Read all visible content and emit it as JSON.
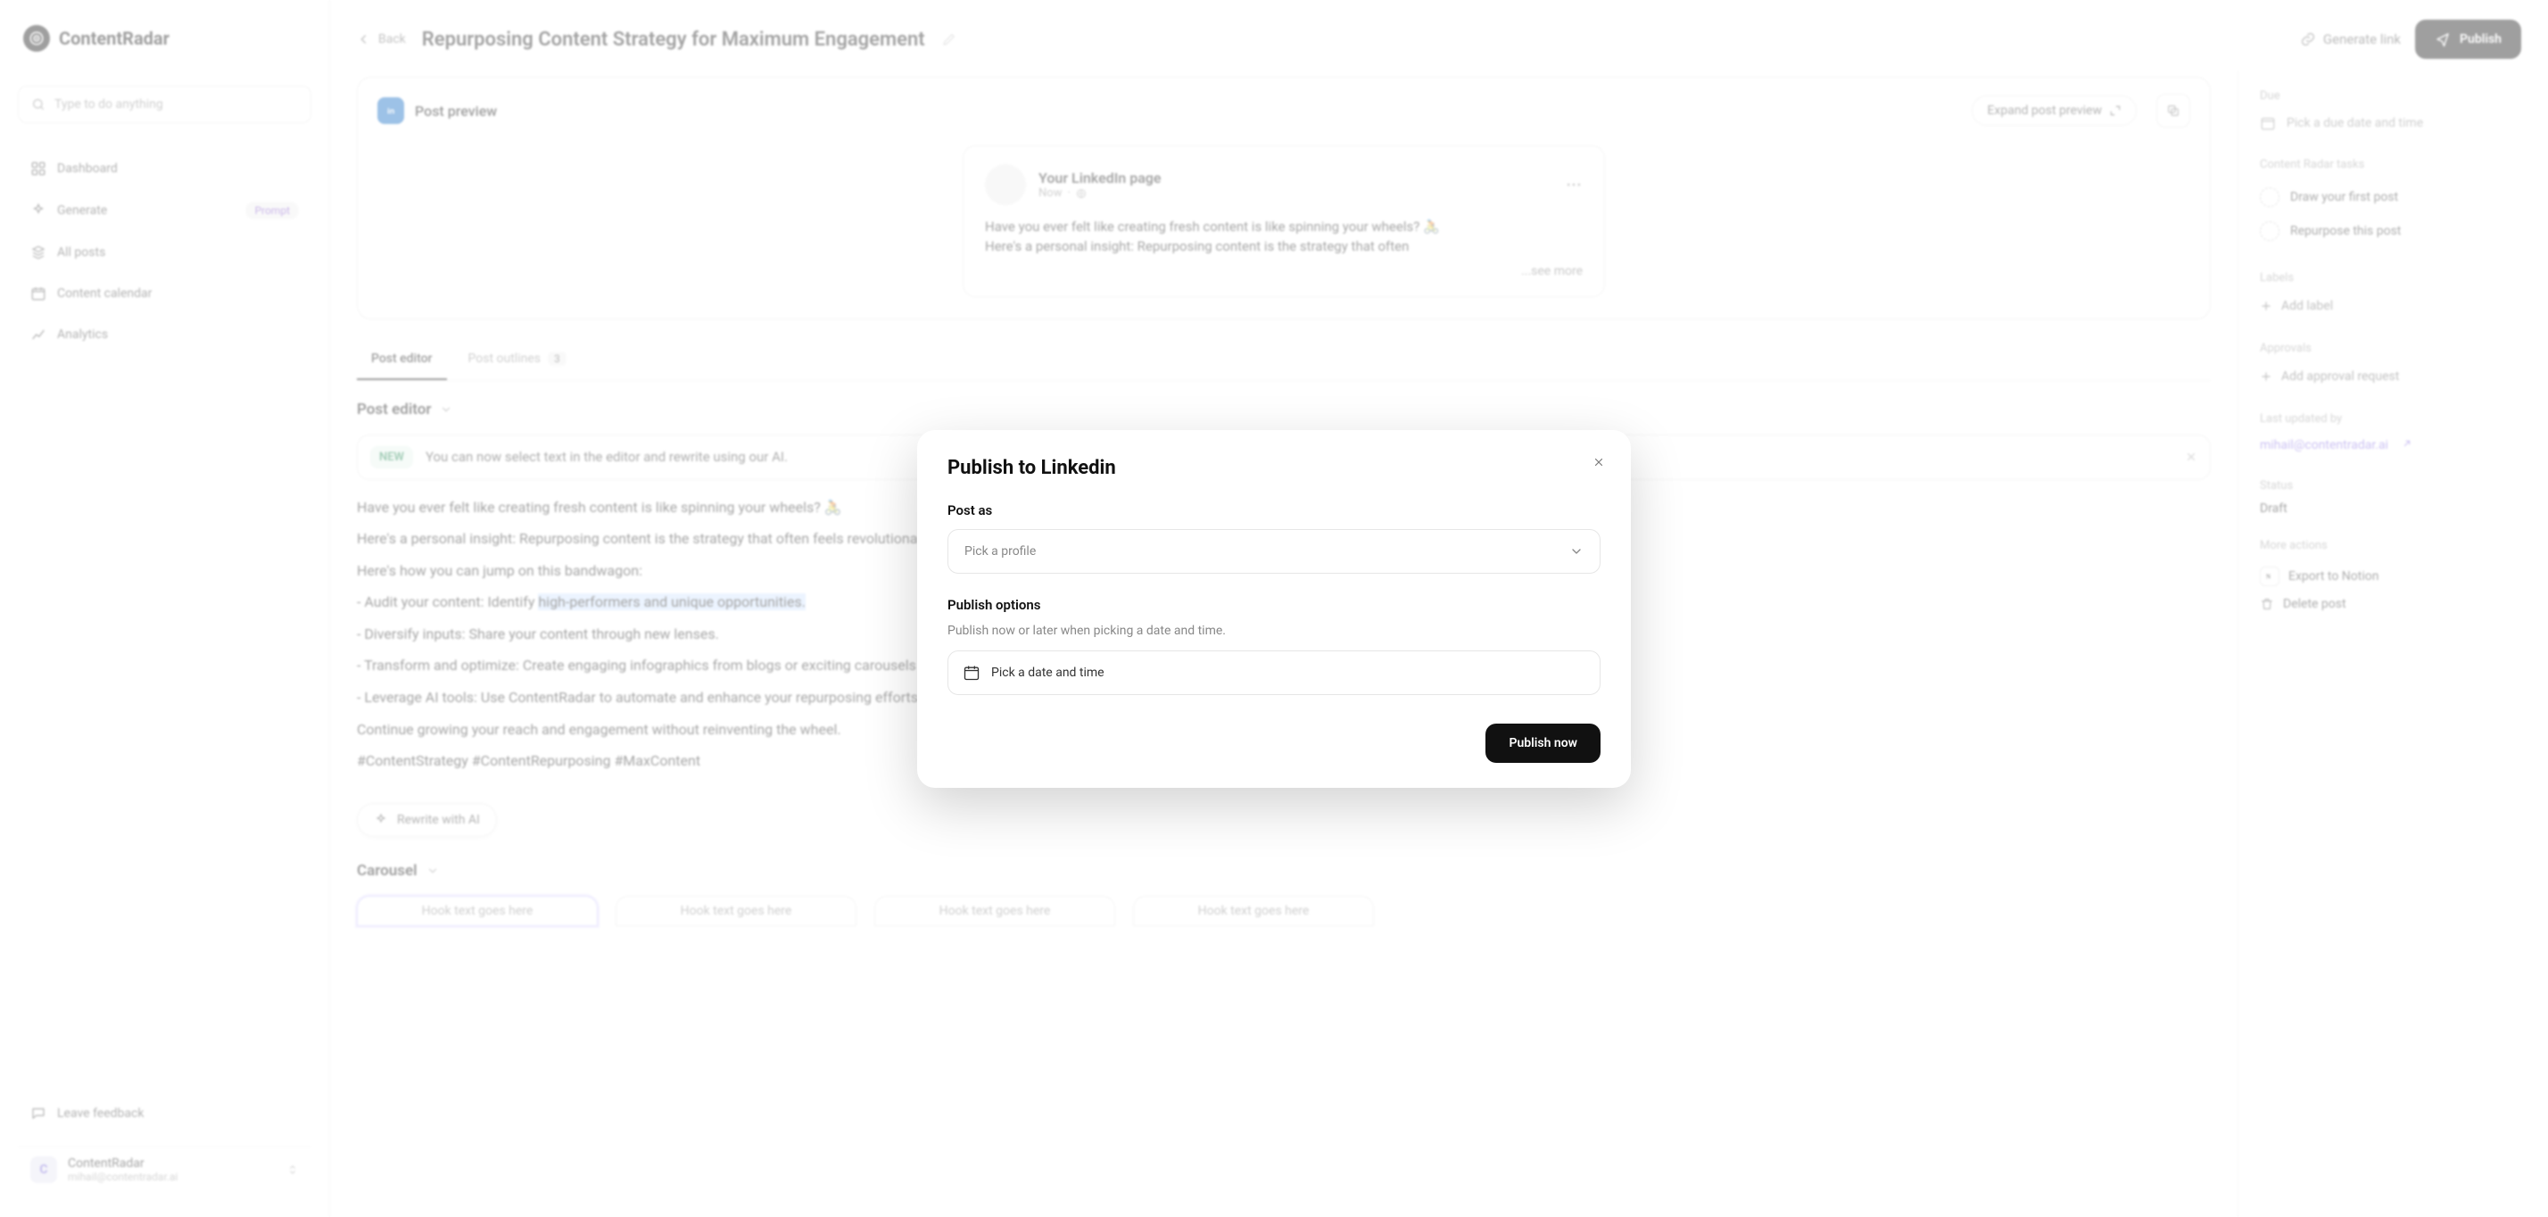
{
  "brand": {
    "name": "ContentRadar"
  },
  "search": {
    "placeholder": "Type to do anything"
  },
  "nav": {
    "dashboard": "Dashboard",
    "generate": "Generate",
    "generate_badge": "Prompt",
    "all_posts": "All posts",
    "content_calendar": "Content calendar",
    "analytics": "Analytics"
  },
  "feedback": "Leave feedback",
  "workspace": {
    "name": "ContentRadar",
    "email": "mihail@contentradar.ai"
  },
  "topbar": {
    "back": "Back",
    "title": "Repurposing Content Strategy for Maximum Engagement",
    "generate_link": "Generate link",
    "publish": "Publish"
  },
  "preview": {
    "label": "Post preview",
    "expand": "Expand post preview",
    "page_name": "Your LinkedIn page",
    "now": "Now",
    "body_line1": "Have you ever felt like creating fresh content is like spinning your wheels? 🚴",
    "body_line2": "Here's a personal insight: Repurposing content is the strategy that often",
    "see_more": "...see more"
  },
  "tabs": {
    "editor": "Post editor",
    "outlines": "Post outlines",
    "outlines_count": "3"
  },
  "editor": {
    "heading": "Post editor",
    "new_chip": "NEW",
    "new_msg": "You can now select text in the editor and rewrite using our AI.",
    "p1": "Have you ever felt like creating fresh content is like spinning your wheels? 🚴",
    "p2a": "Here's a personal insight: Repurposing content is the strategy that often feels revolutionary yet gets overlooked. It's about breathing new life into existing ideas. And that's powerful.",
    "p3": "Here's how you can jump on this bandwagon:",
    "b1a": "- Audit your content: Identify ",
    "b1b": "high-performers and unique opportunities.",
    "b2": "- Diversify inputs: Share your content through new lenses.",
    "b3": "- Transform and optimize: Create engaging infographics from blogs or exciting carousels from PDFs and adjust for each platform.",
    "b4": "- Leverage AI tools: Use ContentRadar to automate and enhance your repurposing efforts.",
    "p4": "Continue growing your reach and engagement without reinventing the wheel.",
    "p5": "#ContentStrategy #ContentRepurposing #MaxContent",
    "rewrite": "Rewrite with AI"
  },
  "carousel": {
    "heading": "Carousel",
    "cards": [
      "Hook text goes here",
      "Hook text goes here",
      "Hook text goes here",
      "Hook text goes here"
    ]
  },
  "right": {
    "due_label": "Due",
    "due_value": "Pick a due date and time",
    "tasks_label": "Content Radar tasks",
    "task1": "Draw your first post",
    "task2": "Repurpose this post",
    "labels_label": "Labels",
    "add_label": "Add label",
    "approvals_label": "Approvals",
    "add_approval": "Add approval request",
    "updated_label": "Last updated by",
    "updated_value": "mihail@contentradar.ai",
    "status_label": "Status",
    "status_value": "Draft",
    "actions_label": "More actions",
    "export_notion": "Export to Notion",
    "delete_post": "Delete post"
  },
  "modal": {
    "title": "Publish to Linkedin",
    "post_as_label": "Post as",
    "post_as_placeholder": "Pick a profile",
    "options_label": "Publish options",
    "options_sub": "Publish now or later when picking a date and time.",
    "datetime": "Pick a date and time",
    "publish_now": "Publish now"
  }
}
